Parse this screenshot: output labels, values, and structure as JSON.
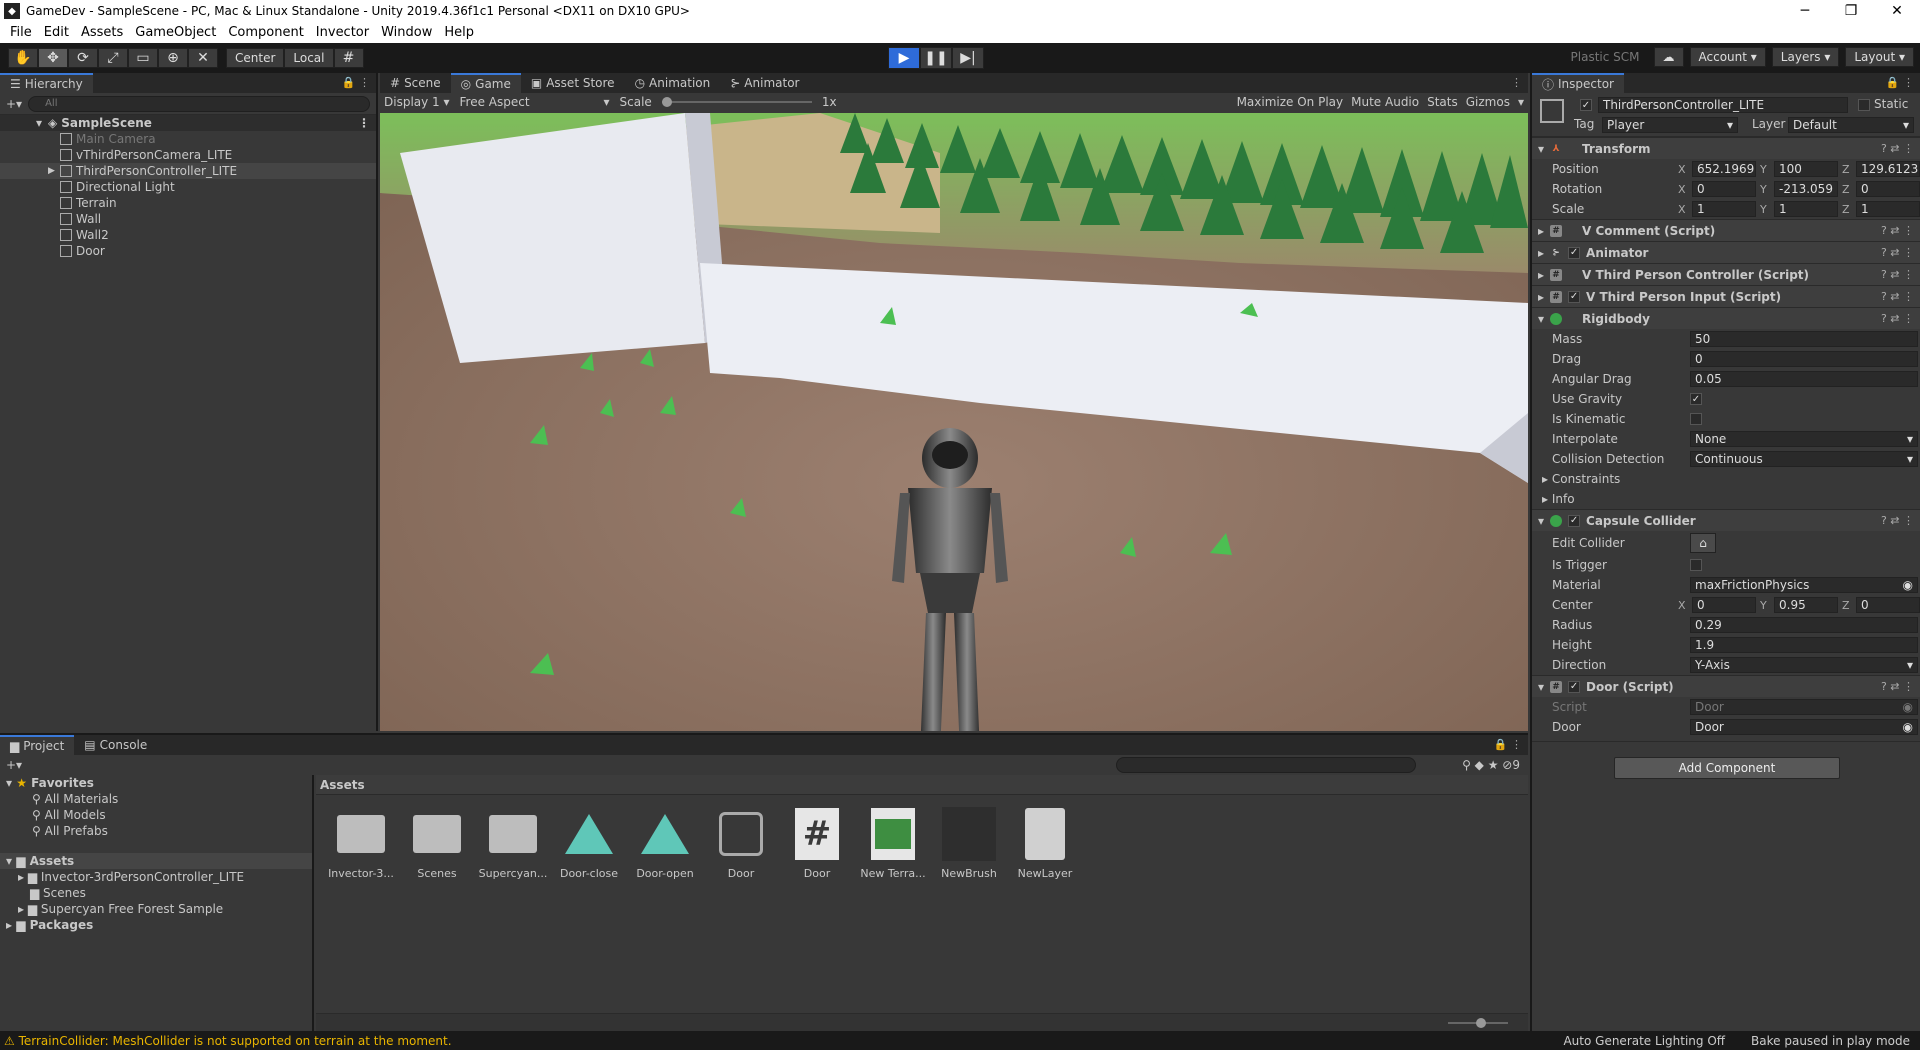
{
  "window": {
    "title": "GameDev - SampleScene - PC, Mac & Linux Standalone - Unity 2019.4.36f1c1 Personal <DX11 on DX10 GPU>",
    "min": "─",
    "max": "❐",
    "close": "✕"
  },
  "menu": [
    "File",
    "Edit",
    "Assets",
    "GameObject",
    "Component",
    "Invector",
    "Window",
    "Help"
  ],
  "toolbar": {
    "center": "Center",
    "local": "Local",
    "plastic": "Plastic SCM",
    "account": "Account",
    "layers": "Layers",
    "layout": "Layout"
  },
  "hierarchy": {
    "tab": "Hierarchy",
    "search_placeholder": "All",
    "scene": "SampleScene",
    "items": [
      "Main Camera",
      "vThirdPersonCamera_LITE",
      "ThirdPersonController_LITE",
      "Directional Light",
      "Terrain",
      "Wall",
      "Wall2",
      "Door"
    ]
  },
  "game": {
    "tabs": [
      "Scene",
      "Game",
      "Asset Store",
      "Animation",
      "Animator"
    ],
    "display": "Display 1",
    "aspect": "Free Aspect",
    "scale_label": "Scale",
    "scale_value": "1x",
    "right": [
      "Maximize On Play",
      "Mute Audio",
      "Stats",
      "Gizmos"
    ]
  },
  "inspector": {
    "tab": "Inspector",
    "object": "ThirdPersonController_LITE",
    "static": "Static",
    "tag_label": "Tag",
    "tag": "Player",
    "layer_label": "Layer",
    "layer": "Default",
    "transform": {
      "name": "Transform",
      "position_label": "Position",
      "rotation_label": "Rotation",
      "scale_label": "Scale",
      "position": [
        "652.1969",
        "100",
        "129.6123"
      ],
      "rotation": [
        "0",
        "-213.059",
        "0"
      ],
      "scale": [
        "1",
        "1",
        "1"
      ]
    },
    "components": [
      "V Comment (Script)",
      "Animator",
      "V Third Person Controller (Script)",
      "V Third Person Input (Script)"
    ],
    "rigidbody": {
      "name": "Rigidbody",
      "mass_label": "Mass",
      "mass": "50",
      "drag_label": "Drag",
      "drag": "0",
      "adrag_label": "Angular Drag",
      "adrag": "0.05",
      "gravity_label": "Use Gravity",
      "kinematic_label": "Is Kinematic",
      "interp_label": "Interpolate",
      "interp": "None",
      "coll_label": "Collision Detection",
      "coll": "Continuous",
      "constraints": "Constraints",
      "info": "Info"
    },
    "capsule": {
      "name": "Capsule Collider",
      "edit_label": "Edit Collider",
      "trigger_label": "Is Trigger",
      "material_label": "Material",
      "material": "maxFrictionPhysics",
      "center_label": "Center",
      "center": [
        "0",
        "0.95",
        "0"
      ],
      "radius_label": "Radius",
      "radius": "0.29",
      "height_label": "Height",
      "height": "1.9",
      "dir_label": "Direction",
      "dir": "Y-Axis"
    },
    "door": {
      "name": "Door (Script)",
      "script_label": "Script",
      "script": "Door",
      "door_label": "Door",
      "door": "Door"
    },
    "add_component": "Add Component"
  },
  "project": {
    "tabs": [
      "Project",
      "Console"
    ],
    "favorites": "Favorites",
    "fav_items": [
      "All Materials",
      "All Models",
      "All Prefabs"
    ],
    "assets_root": "Assets",
    "folders": [
      "Invector-3rdPersonController_LITE",
      "Scenes",
      "Supercyan Free Forest Sample"
    ],
    "packages": "Packages",
    "assets_header": "Assets",
    "count": "9",
    "assets": [
      "Invector-3...",
      "Scenes",
      "Supercyan...",
      "Door-close",
      "Door-open",
      "Door",
      "Door",
      "New Terra...",
      "NewBrush",
      "NewLayer"
    ]
  },
  "status": {
    "warning": "TerrainCollider: MeshCollider is not supported on terrain at the moment.",
    "lighting": "Auto Generate Lighting Off",
    "bake": "Bake paused in play mode"
  }
}
